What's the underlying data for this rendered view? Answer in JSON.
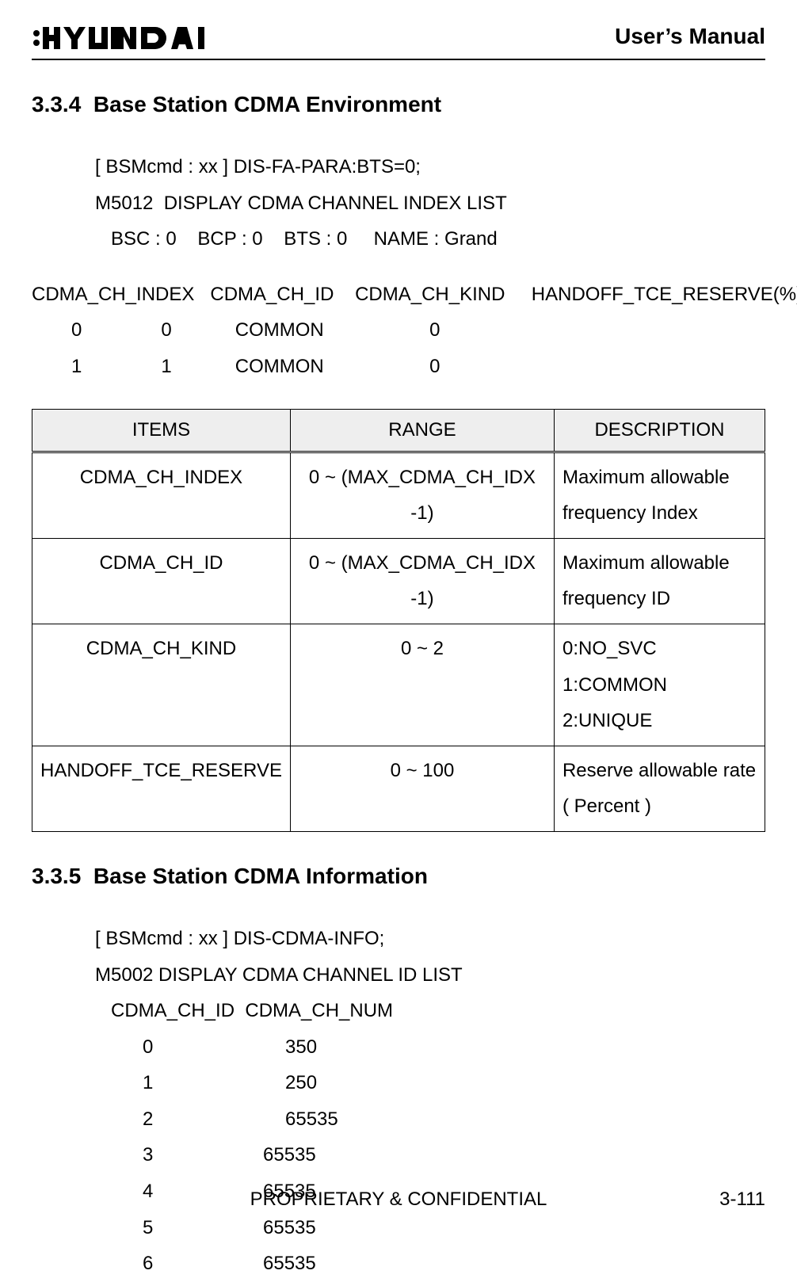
{
  "header": {
    "logo_alt": "HYUNDAI",
    "title": "User’s Manual"
  },
  "section_334": {
    "number": "3.3.4",
    "title": "Base Station CDMA Environment",
    "lines": {
      "cmd": "[ BSMcmd : xx ] DIS-FA-PARA:BTS=0;",
      "msg": "M5012  DISPLAY CDMA CHANNEL INDEX LIST",
      "info": "BSC : 0    BCP : 0    BTS : 0     NAME : Grand"
    },
    "columns_line": "CDMA_CH_INDEX   CDMA_CH_ID    CDMA_CH_KIND     HANDOFF_TCE_RESERVE(%)",
    "rows": [
      "0               0            COMMON                    0",
      "1               1            COMMON                    0"
    ]
  },
  "param_table": {
    "headers": {
      "items": "ITEMS",
      "range": "RANGE",
      "desc": "DESCRIPTION"
    },
    "rows": [
      {
        "items": "CDMA_CH_INDEX",
        "range": "0 ~ (MAX_CDMA_CH_IDX -1)",
        "desc": "Maximum allowable frequency Index"
      },
      {
        "items": "CDMA_CH_ID",
        "range": "0 ~ (MAX_CDMA_CH_IDX -1)",
        "desc": "Maximum allowable frequency ID"
      },
      {
        "items": "CDMA_CH_KIND",
        "range": "0 ~ 2",
        "desc": "0:NO_SVC 1:COMMON 2:UNIQUE"
      },
      {
        "items": "HANDOFF_TCE_RESERVE",
        "range": "0 ~ 100",
        "desc": "Reserve allowable rate ( Percent )"
      }
    ]
  },
  "section_335": {
    "number": "3.3.5",
    "title": "Base Station CDMA Information",
    "lines": {
      "cmd": "[ BSMcmd : xx ] DIS-CDMA-INFO;",
      "msg": "M5002 DISPLAY CDMA CHANNEL ID LIST",
      "cols": "CDMA_CH_ID  CDMA_CH_NUM"
    },
    "rows": [
      {
        "id": "0",
        "num": "350"
      },
      {
        "id": "1",
        "num": "250"
      },
      {
        "id": "2",
        "num": "65535"
      },
      {
        "id": "3",
        "num": "65535"
      },
      {
        "id": "4",
        "num": "65535"
      },
      {
        "id": "5",
        "num": "65535"
      },
      {
        "id": "6",
        "num": "65535"
      }
    ]
  },
  "footer": {
    "center": "PROPRIETARY & CONFIDENTIAL",
    "page": "3-111"
  }
}
